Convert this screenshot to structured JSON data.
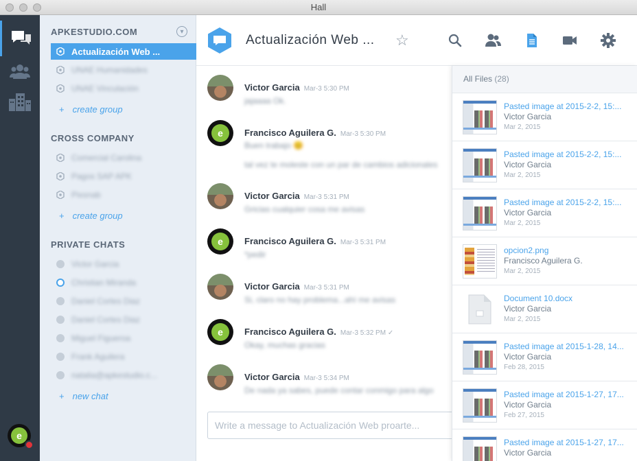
{
  "window": {
    "title": "Hall"
  },
  "sidebar": {
    "sections": [
      {
        "title": "APKESTUDIO.COM"
      },
      {
        "title": "CROSS COMPANY"
      },
      {
        "title": "PRIVATE CHATS"
      }
    ],
    "groups_apke": [
      {
        "label": "Actualización Web ..."
      },
      {
        "label": "UNAE Humanidades"
      },
      {
        "label": "UNAE Vinculación"
      }
    ],
    "groups_cross": [
      {
        "label": "Comercial Carolina"
      },
      {
        "label": "Pagos SAP APK"
      },
      {
        "label": "Pixsnab"
      }
    ],
    "private_chats": [
      {
        "label": "Victor Garcia"
      },
      {
        "label": "Christian Miranda"
      },
      {
        "label": "Daniel Cortes Diaz"
      },
      {
        "label": "Daniel Cortes Diaz"
      },
      {
        "label": "Miguel Figueroa"
      },
      {
        "label": "Frank Aguilera"
      },
      {
        "label": "natalia@apkestudio.c..."
      }
    ],
    "create_group_label": "create group",
    "new_chat_label": "new chat",
    "plus": "+"
  },
  "header": {
    "room_name": "Actualización Web ...",
    "star": "☆"
  },
  "messages": [
    {
      "name": "Victor Garcia",
      "time": "Mar-3 5:30 PM",
      "avatar": "photo",
      "lines": [
        "jajaaaa Ok."
      ]
    },
    {
      "name": "Francisco Aguilera G.",
      "time": "Mar-3 5:30 PM",
      "avatar": "logo",
      "lines": [
        "Buen trabajo 😊",
        "tal vez te moleste con un par de cambios adicionales"
      ]
    },
    {
      "name": "Victor Garcia",
      "time": "Mar-3 5:31 PM",
      "avatar": "photo",
      "lines": [
        "Gricias cualquier cosa me avisas"
      ]
    },
    {
      "name": "Francisco Aguilera G.",
      "time": "Mar-3 5:31 PM",
      "avatar": "logo",
      "lines": [
        "*pedir"
      ]
    },
    {
      "name": "Victor Garcia",
      "time": "Mar-3 5:31 PM",
      "avatar": "photo",
      "lines": [
        "Si, claro no hay problema...ahí me avisas"
      ]
    },
    {
      "name": "Francisco Aguilera G.",
      "time": "Mar-3 5:32 PM ✓",
      "avatar": "logo",
      "lines": [
        "Okay, muchas gracias"
      ]
    },
    {
      "name": "Victor Garcia",
      "time": "Mar-3 5:34 PM",
      "avatar": "photo",
      "lines": [
        "De nada ya sabes, puede contar conmigo para algo"
      ]
    }
  ],
  "composer": {
    "placeholder": "Write a message to Actualización Web proarte..."
  },
  "files": {
    "title": "All Files",
    "count": "(28)",
    "items": [
      {
        "name": "Pasted image at 2015-2-2, 15:...",
        "user": "Victor Garcia",
        "date": "Mar 2, 2015",
        "thumb": "screen"
      },
      {
        "name": "Pasted image at 2015-2-2, 15:...",
        "user": "Victor Garcia",
        "date": "Mar 2, 2015",
        "thumb": "screen"
      },
      {
        "name": "Pasted image at 2015-2-2, 15:...",
        "user": "Victor Garcia",
        "date": "Mar 2, 2015",
        "thumb": "screen"
      },
      {
        "name": "opcion2.png",
        "user": "Francisco Aguilera G.",
        "date": "Mar 2, 2015",
        "thumb": "doc"
      },
      {
        "name": "Document 10.docx",
        "user": "Victor Garcia",
        "date": "Mar 2, 2015",
        "thumb": "blank"
      },
      {
        "name": "Pasted image at 2015-1-28, 14...",
        "user": "Victor Garcia",
        "date": "Feb 28, 2015",
        "thumb": "screen"
      },
      {
        "name": "Pasted image at 2015-1-27, 17...",
        "user": "Victor Garcia",
        "date": "Feb 27, 2015",
        "thumb": "screen"
      },
      {
        "name": "Pasted image at 2015-1-27, 17...",
        "user": "Victor Garcia",
        "date": "",
        "thumb": "screen"
      }
    ]
  },
  "colors": {
    "accent": "#4aa3ea",
    "rail": "#2f3a46",
    "sidebar": "#e8eef5",
    "brand_green": "#86c23c"
  },
  "icons": {
    "rail": [
      "chat-bubbles-icon",
      "people-icon",
      "company-building-icon"
    ],
    "header": [
      "search-icon",
      "members-icon",
      "files-icon",
      "video-icon",
      "gear-icon"
    ]
  },
  "avatar_letter": "e"
}
